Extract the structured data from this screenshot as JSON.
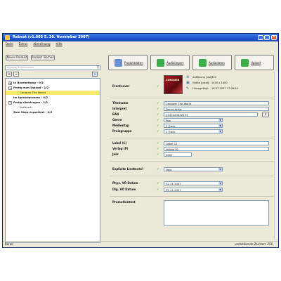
{
  "window": {
    "title": "Rebeat (v1.005 5. 20. November 2007)"
  },
  "menu": [
    "Datei",
    "Extras",
    "Abrechnung",
    "Hilfe"
  ],
  "left": {
    "new_product": "Neues Produkt",
    "delete_product": "Produkt löschen",
    "search_placeholder": "Release durchsuchen",
    "tree": [
      {
        "label": "In Bearbeitung - 0/2",
        "bold": true,
        "expander": "+",
        "check": false,
        "highlight": false
      },
      {
        "label": "Fertig zum Upload - 1/2",
        "bold": true,
        "expander": "−",
        "check": false,
        "highlight": false
      },
      {
        "label": "Conquer The World",
        "bold": false,
        "expander": "",
        "check": true,
        "highlight": true
      },
      {
        "label": "Im Uploadprozess - 0/2",
        "bold": true,
        "expander": "",
        "check": false,
        "highlight": false
      },
      {
        "label": "Fertig übertragen - 1/2",
        "bold": true,
        "expander": "−",
        "check": false,
        "highlight": false
      },
      {
        "label": "Aufbruch",
        "bold": false,
        "expander": "",
        "check": true,
        "highlight": false
      },
      {
        "label": "Zum Shop exportiert - 0/2",
        "bold": true,
        "expander": "",
        "check": false,
        "highlight": false
      }
    ]
  },
  "tabs": [
    {
      "label": "Produktdaten",
      "color": "#6b8fd6"
    },
    {
      "label": "Audioimport",
      "color": "#3bb04a"
    },
    {
      "label": "Audiodaten",
      "color": "#3bb04a"
    },
    {
      "label": "Upload",
      "color": "#3bb04a"
    }
  ],
  "form": {
    "frontcover_label": "Frontcover",
    "cover_text": "CONQUER",
    "info": [
      {
        "label": "Auflösung [dpi]:",
        "value": "300"
      },
      {
        "label": "Größe [pixel]:",
        "value": "1400 x 1400"
      },
      {
        "label": "Hinzugefügt:",
        "value": "16.07.2007 17:06:54"
      }
    ],
    "titel_label": "Titelname",
    "titel_value": "Conquer The World",
    "interpret_label": "Interpret",
    "interpret_value": "Demo Artist",
    "ean_label": "EAN",
    "ean_value": "2345443452234",
    "ean_btn": "$",
    "genre_label": "Genre",
    "genre_value": "Pop",
    "medientyp_label": "Medientyp",
    "medientyp_value": "2 Track",
    "preisgruppe_label": "Preisgruppe",
    "preisgruppe_value": "2 Track",
    "label_label": "Label (C)",
    "label_value": "Label 01",
    "verlag_label": "Verlag (P)",
    "verlag_value": "Verlag 01",
    "jahr_label": "Jahr",
    "jahr_value": "2007",
    "explicit_label": "Explizite Liedtexte?",
    "explicit_value": "Nein",
    "phys_label": "Phys. VÖ Datum",
    "phys_value": "22.11.2007",
    "dig_label": "Dig. VÖ Datum",
    "dig_value": "22.11.2007",
    "promo_label": "Promotiontext"
  },
  "status": {
    "left": "Bereit",
    "right": "verbleibende Zeichen: 256"
  }
}
